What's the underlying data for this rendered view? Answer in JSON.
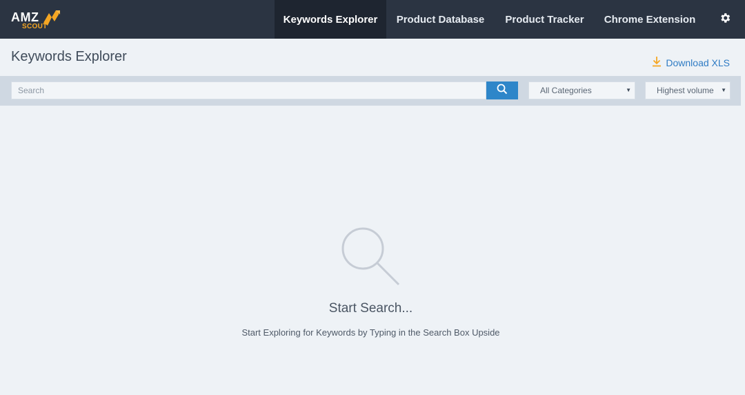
{
  "logo": {
    "primary": "AMZ",
    "secondary": "SCOUT"
  },
  "nav": {
    "items": [
      {
        "label": "Keywords Explorer",
        "active": true
      },
      {
        "label": "Product Database",
        "active": false
      },
      {
        "label": "Product Tracker",
        "active": false
      },
      {
        "label": "Chrome Extension",
        "active": false
      }
    ],
    "settings_icon": "gear-icon"
  },
  "page": {
    "title": "Keywords Explorer",
    "download_label": "Download XLS",
    "download_icon": "download-icon"
  },
  "search": {
    "placeholder": "Search",
    "value": "",
    "button_icon": "search-icon",
    "category_selected": "All Categories",
    "sort_selected": "Highest volume"
  },
  "empty_state": {
    "icon": "magnifier-icon",
    "title": "Start Search...",
    "subtitle": "Start Exploring for Keywords by Typing in the Search Box Upside"
  },
  "colors": {
    "topbar": "#2b3442",
    "active_tab": "#1e2530",
    "accent_blue": "#2e86c9",
    "accent_orange": "#f5a623",
    "background": "#eef2f6"
  }
}
